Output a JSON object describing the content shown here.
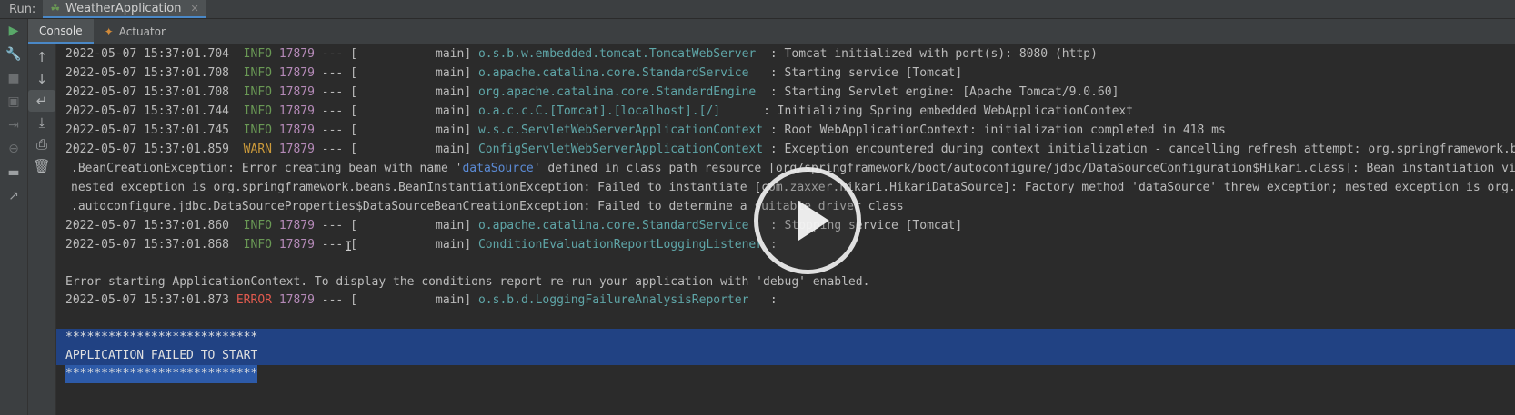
{
  "run_bar": {
    "label": "Run:",
    "tab_title": "WeatherApplication"
  },
  "sub_tabs": [
    {
      "label": "Console"
    },
    {
      "label": "Actuator"
    }
  ],
  "log_lines": [
    {
      "ts": "2022-05-07 15:37:01.704",
      "level": "INFO",
      "pid": "17879",
      "sep": " --- [",
      "thread": "           main]",
      "logger": "o.s.b.w.embedded.tomcat.TomcatWebServer  ",
      "msg": ": Tomcat initialized with port(s): 8080 (http)"
    },
    {
      "ts": "2022-05-07 15:37:01.708",
      "level": "INFO",
      "pid": "17879",
      "sep": " --- [",
      "thread": "           main]",
      "logger": "o.apache.catalina.core.StandardService   ",
      "msg": ": Starting service [Tomcat]"
    },
    {
      "ts": "2022-05-07 15:37:01.708",
      "level": "INFO",
      "pid": "17879",
      "sep": " --- [",
      "thread": "           main]",
      "logger": "org.apache.catalina.core.StandardEngine  ",
      "msg": ": Starting Servlet engine: [Apache Tomcat/9.0.60]"
    },
    {
      "ts": "2022-05-07 15:37:01.744",
      "level": "INFO",
      "pid": "17879",
      "sep": " --- [",
      "thread": "           main]",
      "logger": "o.a.c.c.C.[Tomcat].[localhost].[/]      ",
      "msg": ": Initializing Spring embedded WebApplicationContext"
    },
    {
      "ts": "2022-05-07 15:37:01.745",
      "level": "INFO",
      "pid": "17879",
      "sep": " --- [",
      "thread": "           main]",
      "logger": "w.s.c.ServletWebServerApplicationContext ",
      "msg": ": Root WebApplicationContext: initialization completed in 418 ms"
    },
    {
      "ts": "2022-05-07 15:37:01.859",
      "level": "WARN",
      "pid": "17879",
      "sep": " --- [",
      "thread": "           main]",
      "logger": "ConfigServletWebServerApplicationContext ",
      "msg": ": Exception encountered during context initialization - cancelling refresh attempt: org.springframework.b"
    }
  ],
  "exception_lines": [
    {
      "pre": ".BeanCreationException: Error creating bean with name '",
      "link": "dataSource",
      "post": "' defined in class path resource [org/springframework/boot/autoconfigure/jdbc/DataSourceConfiguration$Hikari.class]: Bean instantiation vi"
    },
    {
      "pre": "nested exception is org.springframework.beans.BeanInstantiationException: Failed to instantiate [com.zaxxer.hikari.HikariDataSource]: Factory method 'dataSource' threw exception; nested exception is org.",
      "link": "",
      "post": ""
    },
    {
      "pre": ".autoconfigure.jdbc.DataSourceProperties$DataSourceBeanCreationException: Failed to determine a suitable driver class",
      "link": "",
      "post": ""
    }
  ],
  "log_lines_2": [
    {
      "ts": "2022-05-07 15:37:01.860",
      "level": "INFO",
      "pid": "17879",
      "sep": " --- [",
      "thread": "           main]",
      "logger": "o.apache.catalina.core.StandardService   ",
      "msg": ": Stopping service [Tomcat]"
    },
    {
      "ts": "2022-05-07 15:37:01.868",
      "level": "INFO",
      "pid": "17879",
      "sep": " --- [",
      "thread": "           main]",
      "logger": "ConditionEvaluationReportLoggingListener ",
      "msg": ":"
    }
  ],
  "plain_line": "Error starting ApplicationContext. To display the conditions report re-run your application with 'debug' enabled.",
  "error_line": {
    "ts": "2022-05-07 15:37:01.873",
    "level": "ERROR",
    "pid": "17879",
    "sep": " --- [",
    "thread": "           main]",
    "logger": "o.s.b.d.LoggingFailureAnalysisReporter   ",
    "msg": ":"
  },
  "banner": {
    "stars_top": "***************************",
    "title": "APPLICATION FAILED TO START",
    "stars_bottom": "***************************"
  },
  "colors": {
    "background": "#2b2b2b",
    "info": "#6a9955",
    "warn": "#cc9a3a",
    "error": "#e05a4e",
    "pid": "#b58ab8",
    "logger": "#5fa6a8",
    "selection": "#214283"
  }
}
